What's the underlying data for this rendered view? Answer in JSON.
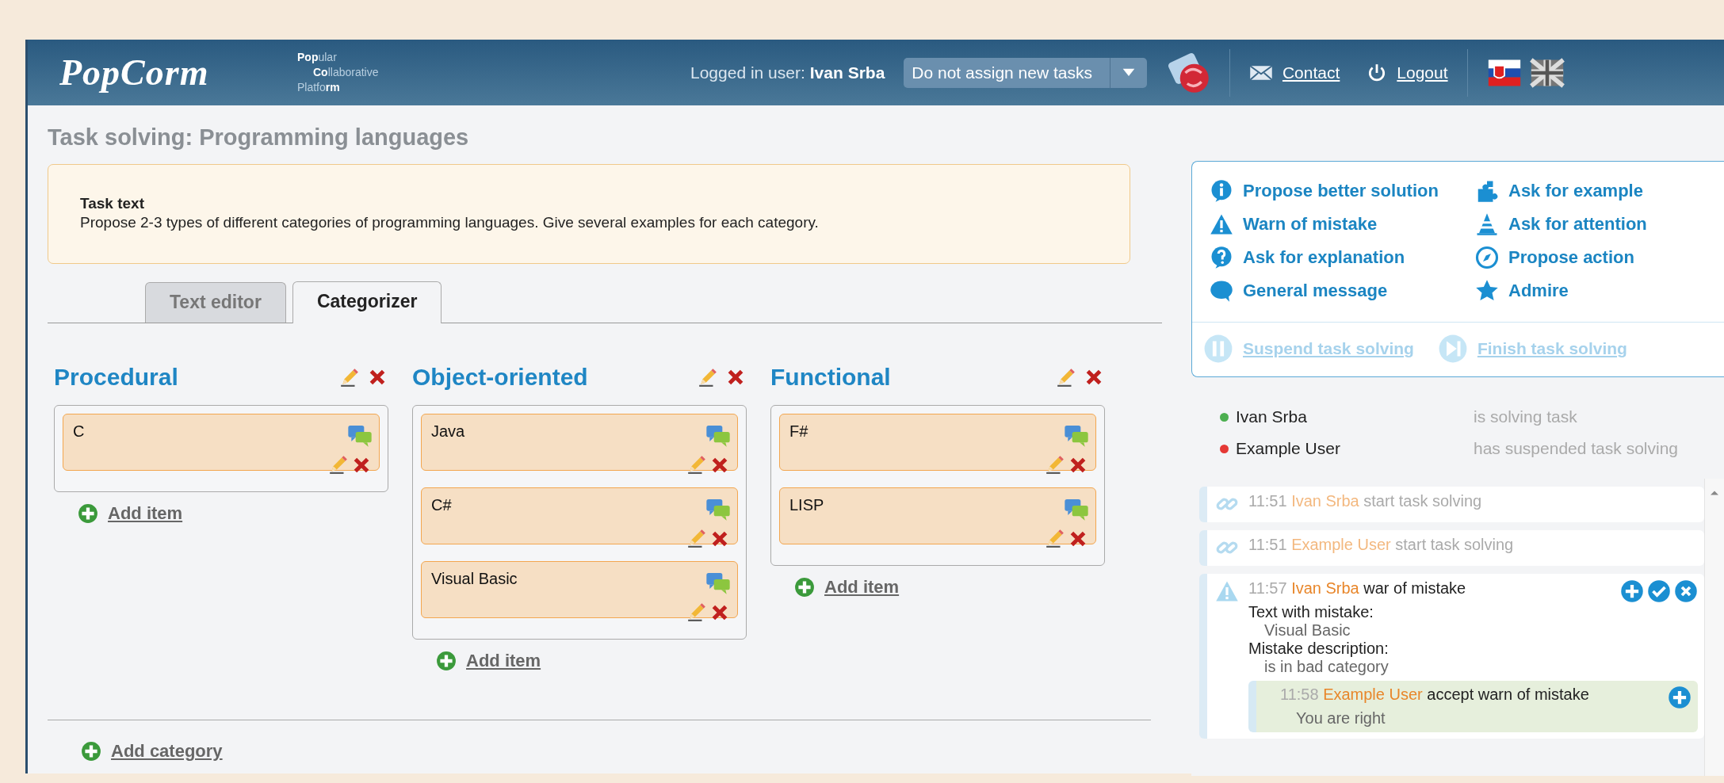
{
  "header": {
    "logo": "PopCorm",
    "tagline": [
      "**Pop**ular",
      "**Co**llaborative",
      "Platfo**rm**"
    ],
    "logged_in_label": "Logged in user:",
    "user": "Ivan Srba",
    "assign_select": {
      "value": "Do not assign new tasks"
    },
    "links": [
      {
        "label": "Contact",
        "kind": "mail"
      },
      {
        "label": "Logout",
        "kind": "power"
      }
    ]
  },
  "page_title": "Task solving: Programming languages",
  "task": {
    "heading": "Task text",
    "text": "Propose 2-3 types of different categories of programming languages. Give several examples for each category."
  },
  "tabs": [
    {
      "label": "Text editor",
      "selected": false
    },
    {
      "label": "Categorizer",
      "selected": true
    }
  ],
  "categories": [
    {
      "name": "Procedural",
      "items": [
        "C"
      ],
      "add_label": "Add item"
    },
    {
      "name": "Object-oriented",
      "items": [
        "Java",
        "C#",
        "Visual Basic"
      ],
      "add_label": "Add item"
    },
    {
      "name": "Functional",
      "items": [
        "F#",
        "LISP"
      ],
      "add_label": "Add item"
    }
  ],
  "add_category": "Add category",
  "actions": [
    {
      "label": "Propose better solution",
      "kind": "info"
    },
    {
      "label": "Ask for example",
      "kind": "puzzle"
    },
    {
      "label": "Warn of mistake",
      "kind": "warning"
    },
    {
      "label": "Ask for attention",
      "kind": "cone"
    },
    {
      "label": "Ask for explanation",
      "kind": "question"
    },
    {
      "label": "Propose action",
      "kind": "compass"
    },
    {
      "label": "General message",
      "kind": "speech"
    },
    {
      "label": "Admire",
      "kind": "star"
    }
  ],
  "task_controls": [
    {
      "label": "Suspend task solving",
      "kind": "pause",
      "disabled": true
    },
    {
      "label": "Finish task solving",
      "kind": "finish",
      "disabled": true
    }
  ],
  "users": [
    {
      "name": "Ivan Srba",
      "status": "is solving task",
      "color": "#4caf50"
    },
    {
      "name": "Example User",
      "status": "has suspended task solving",
      "color": "#e53935"
    }
  ],
  "log": [
    {
      "kind": "link",
      "time": "11:51",
      "user": "Ivan Srba",
      "action": "start task solving"
    },
    {
      "kind": "link",
      "time": "11:51",
      "user": "Example User",
      "action": "start task solving"
    },
    {
      "kind": "warning",
      "time": "11:57",
      "user": "Ivan Srba",
      "action": "war of mistake",
      "details": [
        {
          "label": "Text with mistake:",
          "value": "Visual Basic"
        },
        {
          "label": "Mistake description:",
          "value": "is in bad category"
        }
      ],
      "replies": [
        {
          "time": "11:58",
          "user": "Example User",
          "action": "accept warn of mistake",
          "text": "You are right"
        }
      ]
    }
  ]
}
